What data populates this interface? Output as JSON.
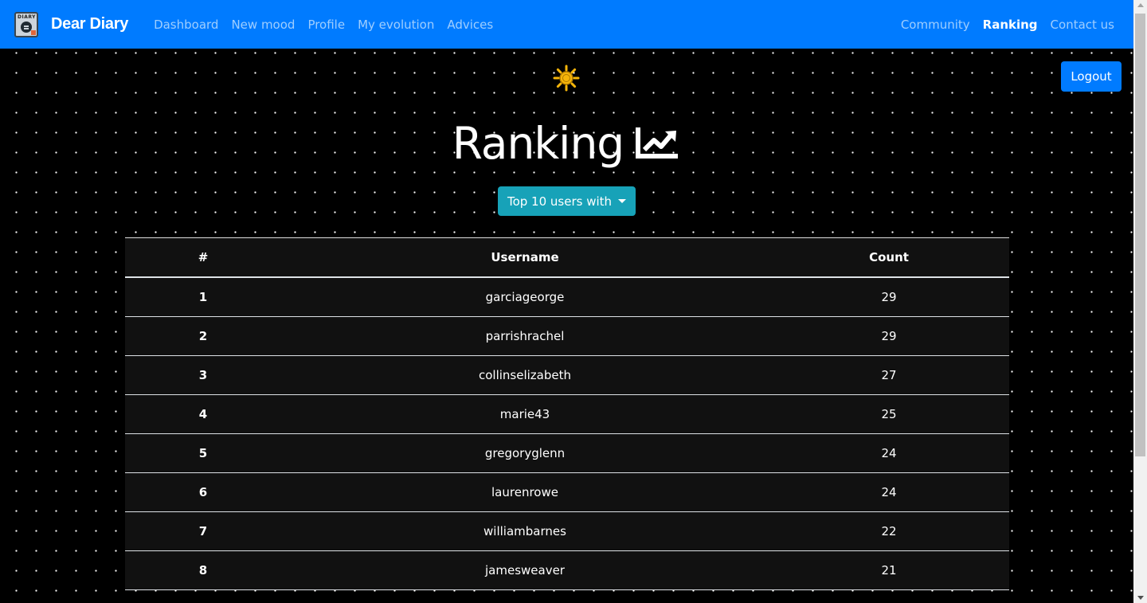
{
  "brand": {
    "name": "Dear Diary",
    "logo_label": "DIARY"
  },
  "nav": {
    "left": [
      "Dashboard",
      "New mood",
      "Profile",
      "My evolution",
      "Advices"
    ],
    "right": [
      "Community",
      "Ranking",
      "Contact us"
    ],
    "active": "Ranking"
  },
  "theme_icon": "sun-icon",
  "logout_label": "Logout",
  "page_title": "Ranking",
  "title_icon": "chart-line-icon",
  "filter_label": "Top 10 users with",
  "table": {
    "headers": [
      "#",
      "Username",
      "Count"
    ],
    "rows": [
      [
        "1",
        "garciageorge",
        "29"
      ],
      [
        "2",
        "parrishrachel",
        "29"
      ],
      [
        "3",
        "collinselizabeth",
        "27"
      ],
      [
        "4",
        "marie43",
        "25"
      ],
      [
        "5",
        "gregoryglenn",
        "24"
      ],
      [
        "6",
        "laurenrowe",
        "24"
      ],
      [
        "7",
        "williambarnes",
        "22"
      ],
      [
        "8",
        "jamesweaver",
        "21"
      ]
    ]
  },
  "colors": {
    "navbar": "#007bff",
    "background": "#000000",
    "table_bg": "#111111",
    "dropdown": "#17a2b8",
    "sun": "#f5b50a"
  }
}
